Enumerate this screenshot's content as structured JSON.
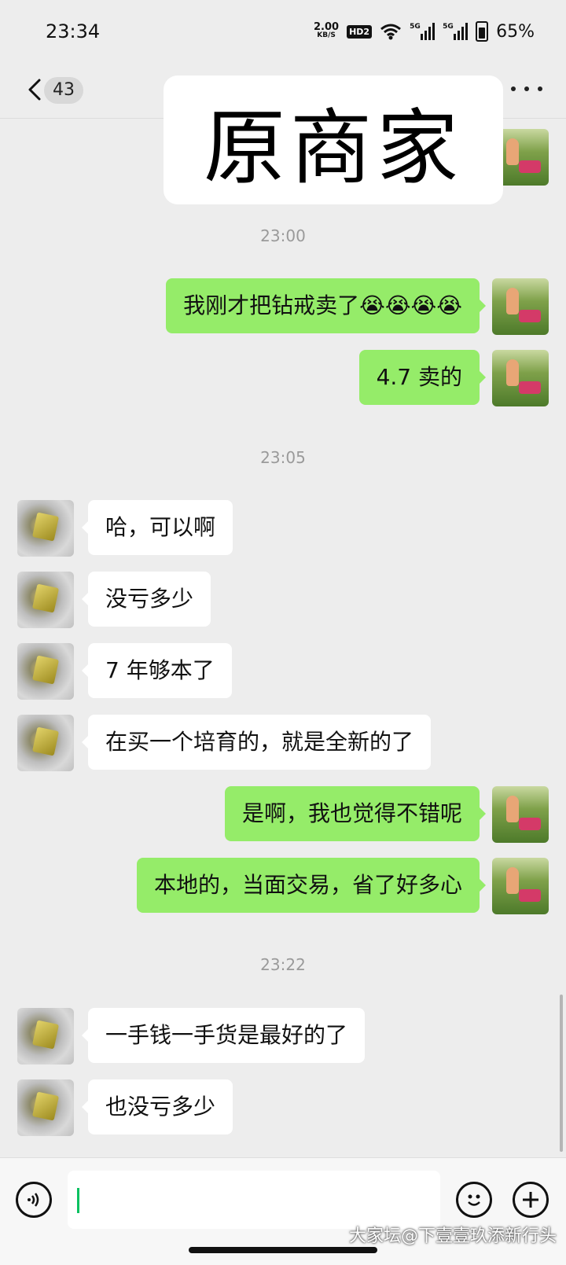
{
  "status_bar": {
    "time": "23:34",
    "net_speed_value": "2.00",
    "net_speed_unit": "KB/S",
    "hd_badge": "HD2",
    "signal1_label": "5G",
    "signal2_label": "5G",
    "battery": "65%"
  },
  "header": {
    "unread_count": "43",
    "back_icon": "chevron-left-icon",
    "more_icon": "ellipsis-icon"
  },
  "overlay_label": "原商家",
  "colors": {
    "outgoing_bubble": "#95ec69",
    "incoming_bubble": "#ffffff",
    "background": "#ededed",
    "caret": "#07c160"
  },
  "timestamps": [
    "23:00",
    "23:05",
    "23:22"
  ],
  "messages": [
    {
      "side": "out",
      "text": "我刚才把钻戒卖了😭😭😭😭"
    },
    {
      "side": "out",
      "text": "4.7 卖的"
    },
    {
      "side": "in",
      "text": "哈，可以啊"
    },
    {
      "side": "in",
      "text": "没亏多少"
    },
    {
      "side": "in",
      "text": "7 年够本了"
    },
    {
      "side": "in",
      "text": "在买一个培育的，就是全新的了"
    },
    {
      "side": "out",
      "text": "是啊，我也觉得不错呢"
    },
    {
      "side": "out",
      "text": "本地的，当面交易，省了好多心"
    },
    {
      "side": "in",
      "text": "一手钱一手货是最好的了"
    },
    {
      "side": "in",
      "text": "也没亏多少"
    }
  ],
  "input_bar": {
    "voice_icon": "voice-icon",
    "emoji_icon": "emoji-icon",
    "plus_icon": "plus-icon",
    "value": ""
  },
  "watermark": "大家坛@下壹壹玖添新行头"
}
